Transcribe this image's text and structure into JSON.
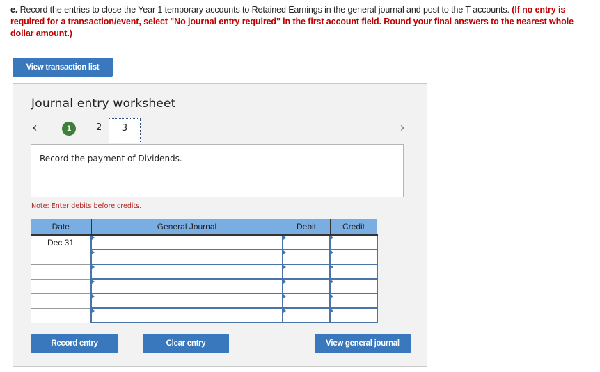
{
  "instructions": {
    "lead": "e.",
    "text": " Record the entries to close the Year 1 temporary accounts to Retained Earnings in the general journal and post to the T-accounts. ",
    "note": "(If no entry is required for a transaction/event, select \"No journal entry required\" in the first account field. Round your final answers to the nearest whole dollar amount.)"
  },
  "view_transaction_list_label": "View transaction list",
  "worksheet": {
    "title": "Journal entry worksheet",
    "nav_prev_icon": "‹",
    "nav_next_icon": "›",
    "steps": [
      "1",
      "2",
      "3"
    ],
    "completed_step": "1",
    "active_step": "3",
    "description": "Record the payment of Dividends.",
    "note": "Note: Enter debits before credits.",
    "table": {
      "headers": [
        "Date",
        "General Journal",
        "Debit",
        "Credit"
      ],
      "rows": [
        {
          "date": "Dec 31",
          "account": "",
          "debit": "",
          "credit": ""
        },
        {
          "date": "",
          "account": "",
          "debit": "",
          "credit": ""
        },
        {
          "date": "",
          "account": "",
          "debit": "",
          "credit": ""
        },
        {
          "date": "",
          "account": "",
          "debit": "",
          "credit": ""
        },
        {
          "date": "",
          "account": "",
          "debit": "",
          "credit": ""
        },
        {
          "date": "",
          "account": "",
          "debit": "",
          "credit": ""
        }
      ]
    },
    "buttons": {
      "record": "Record entry",
      "clear": "Clear entry",
      "view_general": "View general journal"
    }
  },
  "colors": {
    "button_blue": "#3a78be",
    "header_blue": "#7aaee3",
    "instruction_red": "#c00000",
    "step_complete_green": "#3f7f3a"
  }
}
